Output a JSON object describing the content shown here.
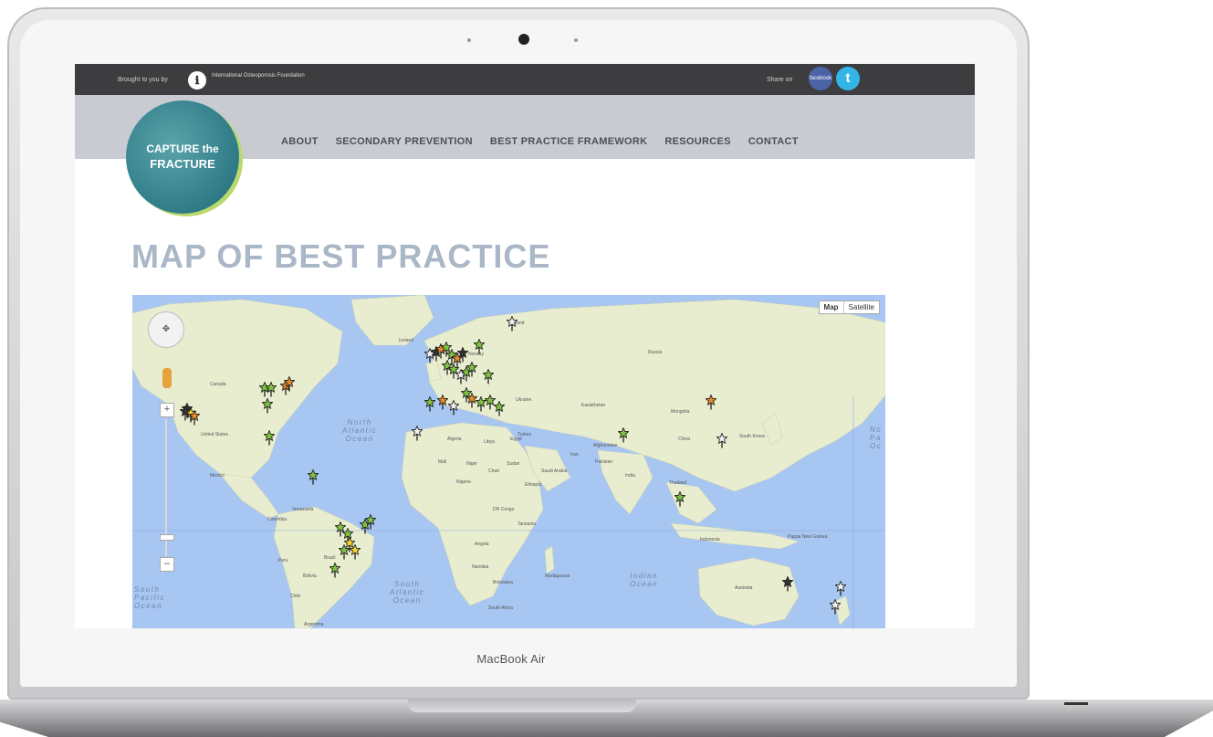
{
  "device": {
    "label": "MacBook Air"
  },
  "topbar": {
    "brought_by": "Brought to you by",
    "org_name": "International Osteoporosis Foundation",
    "share_label": "Share on",
    "facebook_label": "facebook",
    "twitter_icon": "twitter-icon"
  },
  "logo": {
    "line1": "CAPTURE the",
    "line2": "FRACTURE"
  },
  "nav": {
    "items": [
      "ABOUT",
      "SECONDARY PREVENTION",
      "BEST PRACTICE FRAMEWORK",
      "RESOURCES",
      "CONTACT"
    ]
  },
  "page": {
    "title": "MAP OF BEST PRACTICE"
  },
  "map": {
    "type_options": [
      "Map",
      "Satellite"
    ],
    "selected_type": "Map",
    "zoom_in": "+",
    "zoom_out": "–",
    "oceans": {
      "north_atlantic": "North\nAtlantic\nOcean",
      "south_atlantic": "South\nAtlantic\nOcean",
      "indian": "Indian\nOcean",
      "south_pacific": "South\nPacific\nOcean",
      "north_pacific": "No\nPa\nOc"
    },
    "country_labels": [
      "Canada",
      "United States",
      "Mexico",
      "Venezuela",
      "Colombia",
      "Brazil",
      "Peru",
      "Bolivia",
      "Chile",
      "Argentina",
      "Iceland",
      "Finland",
      "Norway",
      "Ukraine",
      "Kazakhstan",
      "Russia",
      "Mongolia",
      "China",
      "Turkey",
      "Iran",
      "Afghanistan",
      "Pakistan",
      "India",
      "Thailand",
      "Indonesia",
      "Papua New Guinea",
      "Australia",
      "South Korea",
      "Algeria",
      "Libya",
      "Egypt",
      "Mali",
      "Niger",
      "Chad",
      "Sudan",
      "Ethiopia",
      "Nigeria",
      "DR Congo",
      "Tanzania",
      "Angola",
      "Namibia",
      "Botswana",
      "Madagascar",
      "South Africa",
      "Saudi Arabia"
    ],
    "marker_colors": {
      "green": "#7fc241",
      "orange": "#e38b2b",
      "yellow": "#f4d72c",
      "white": "#f2f2f2",
      "dark": "#333333"
    }
  }
}
